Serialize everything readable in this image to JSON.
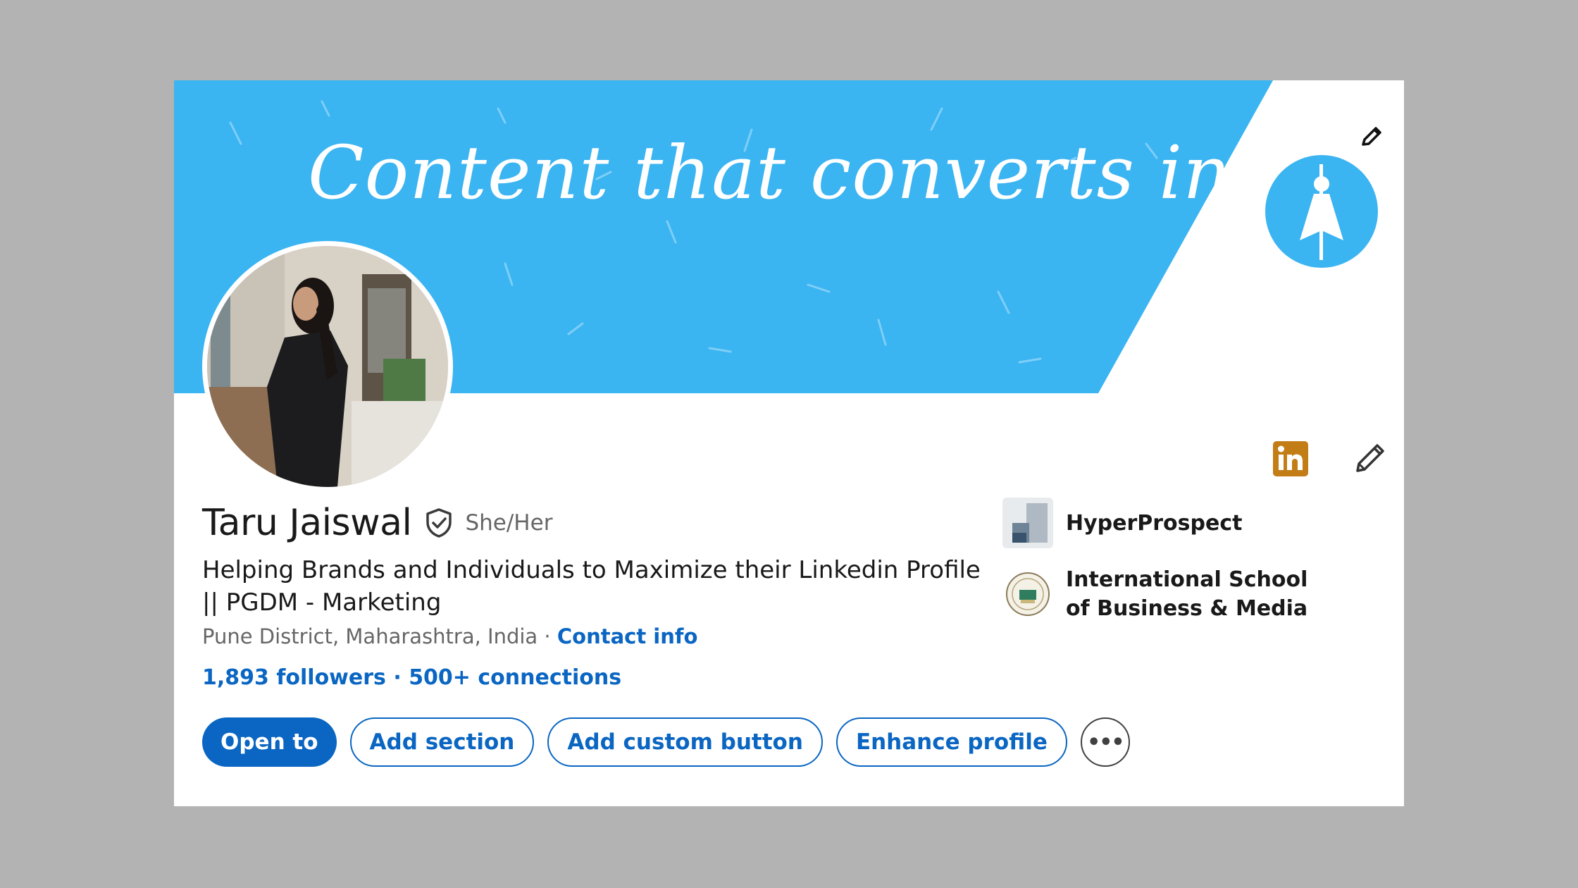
{
  "banner": {
    "headline": "Content that converts into leads",
    "colors": {
      "sky": "#3bb4f2",
      "white": "#ffffff"
    },
    "edit_icon": "pencil-icon",
    "brand_icon": "superhero-logo-icon"
  },
  "profile": {
    "name": "Taru Jaiswal",
    "pronouns": "She/Her",
    "verified_icon": "verified-shield-icon",
    "headline": "Helping Brands and Individuals to Maximize their Linkedin Profile || PGDM - Marketing",
    "location": "Pune District, Maharashtra, India",
    "separator": " · ",
    "contact_info": "Contact info",
    "followers": "1,893 followers",
    "stats_separator": " · ",
    "connections": "500+ connections"
  },
  "actions": {
    "open_to": "Open to",
    "add_section": "Add section",
    "add_custom_button": "Add custom button",
    "enhance_profile": "Enhance profile",
    "more": "•••"
  },
  "experience": [
    {
      "name": "HyperProspect",
      "logo": "hyperprospect-logo"
    },
    {
      "name": "International School of Business & Media",
      "logo": "school-crest-logo"
    }
  ],
  "badges": {
    "linkedin": "in",
    "linkedin_color": "#c37d16",
    "edit_icon": "pencil-icon"
  }
}
